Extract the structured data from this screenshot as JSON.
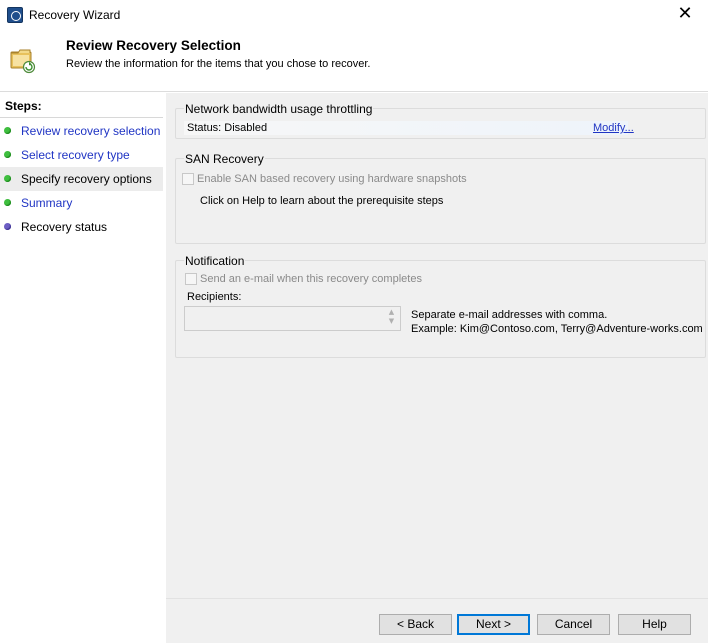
{
  "window": {
    "title": "Recovery Wizard",
    "close_glyph": "✕"
  },
  "header": {
    "title": "Review Recovery Selection",
    "subtitle": "Review the information for the items that you chose to recover."
  },
  "steps": {
    "title": "Steps:",
    "items": [
      {
        "label": "Review recovery selection",
        "state": "link",
        "dot": "green"
      },
      {
        "label": "Select recovery type",
        "state": "link",
        "dot": "green"
      },
      {
        "label": "Specify recovery options",
        "state": "active",
        "dot": "green"
      },
      {
        "label": "Summary",
        "state": "link",
        "dot": "green"
      },
      {
        "label": "Recovery status",
        "state": "plain",
        "dot": "purple"
      }
    ]
  },
  "network": {
    "legend": "Network bandwidth usage throttling",
    "status": "Status: Disabled",
    "modify_link": "Modify..."
  },
  "san": {
    "legend": "SAN Recovery",
    "checkbox_label": "Enable SAN based recovery using hardware snapshots",
    "checked": false,
    "help_note": "Click on Help to learn about the prerequisite steps"
  },
  "notification": {
    "legend": "Notification",
    "checkbox_label": "Send an e-mail when this recovery completes",
    "checked": false,
    "recipients_label": "Recipients:",
    "recipients_value": "",
    "separator_note_line1": "Separate e-mail addresses with comma.",
    "separator_note_line2": "Example: Kim@Contoso.com, Terry@Adventure-works.com"
  },
  "buttons": {
    "back": "< Back",
    "next": "Next >",
    "cancel": "Cancel",
    "help": "Help"
  },
  "colors": {
    "link": "#2035c4",
    "panel_bg": "#f0f0f0",
    "step_dot_done": "#3fbf3f",
    "step_dot_pending": "#6d5fc4",
    "default_button_border": "#0078d7"
  }
}
